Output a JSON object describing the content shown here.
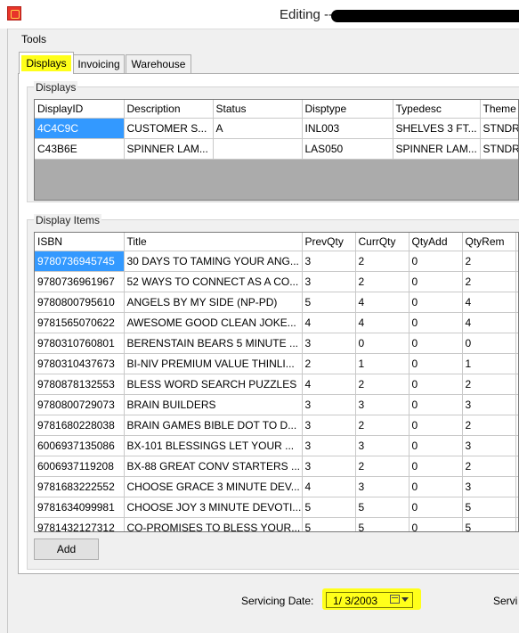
{
  "window": {
    "title": "Editing --"
  },
  "menu": {
    "items": [
      "Tools"
    ]
  },
  "tabs": [
    "Displays",
    "Invoicing",
    "Warehouse"
  ],
  "displays": {
    "label": "Displays",
    "columns": [
      "DisplayID",
      "Description",
      "Status",
      "Disptype",
      "Typedesc",
      "Theme"
    ],
    "rows": [
      [
        "4C4C9C",
        "CUSTOMER S...",
        "A",
        "INL003",
        "SHELVES 3 FT...",
        "STNDR"
      ],
      [
        "C43B6E",
        "SPINNER LAM...",
        "",
        "LAS050",
        "SPINNER LAM...",
        "STNDR"
      ]
    ]
  },
  "items": {
    "label": "Display Items",
    "columns": [
      "ISBN",
      "Title",
      "PrevQty",
      "CurrQty",
      "QtyAdd",
      "QtyRem"
    ],
    "rows": [
      [
        "9780736945745",
        "30 DAYS TO TAMING YOUR ANG...",
        "3",
        "2",
        "0",
        "2"
      ],
      [
        "9780736961967",
        "52 WAYS TO CONNECT AS A CO...",
        "3",
        "2",
        "0",
        "2"
      ],
      [
        "9780800795610",
        "ANGELS BY MY SIDE (NP-PD)",
        "5",
        "4",
        "0",
        "4"
      ],
      [
        "9781565070622",
        "AWESOME GOOD CLEAN JOKE...",
        "4",
        "4",
        "0",
        "4"
      ],
      [
        "9780310760801",
        "BERENSTAIN BEARS 5 MINUTE ...",
        "3",
        "0",
        "0",
        "0"
      ],
      [
        "9780310437673",
        "BI-NIV PREMIUM VALUE THINLI...",
        "2",
        "1",
        "0",
        "1"
      ],
      [
        "9780878132553",
        "BLESS WORD SEARCH PUZZLES",
        "4",
        "2",
        "0",
        "2"
      ],
      [
        "9780800729073",
        "BRAIN BUILDERS",
        "3",
        "3",
        "0",
        "3"
      ],
      [
        "9781680228038",
        "BRAIN GAMES BIBLE DOT TO D...",
        "3",
        "2",
        "0",
        "2"
      ],
      [
        "6006937135086",
        "BX-101 BLESSINGS LET YOUR ...",
        "3",
        "3",
        "0",
        "3"
      ],
      [
        "6006937119208",
        "BX-88 GREAT CONV STARTERS ...",
        "3",
        "2",
        "0",
        "2"
      ],
      [
        "9781683222552",
        "CHOOSE GRACE 3 MINUTE DEV...",
        "4",
        "3",
        "0",
        "3"
      ],
      [
        "9781634099981",
        "CHOOSE JOY 3 MINUTE DEVOTI...",
        "5",
        "5",
        "0",
        "5"
      ],
      [
        "9781432127312",
        "CO-PROMISES TO BLESS YOUR...",
        "5",
        "5",
        "0",
        "5"
      ]
    ]
  },
  "buttons": {
    "add": "Add"
  },
  "servicing": {
    "label": "Servicing Date:",
    "date": "1/  3/2003",
    "label2": "Servi"
  }
}
